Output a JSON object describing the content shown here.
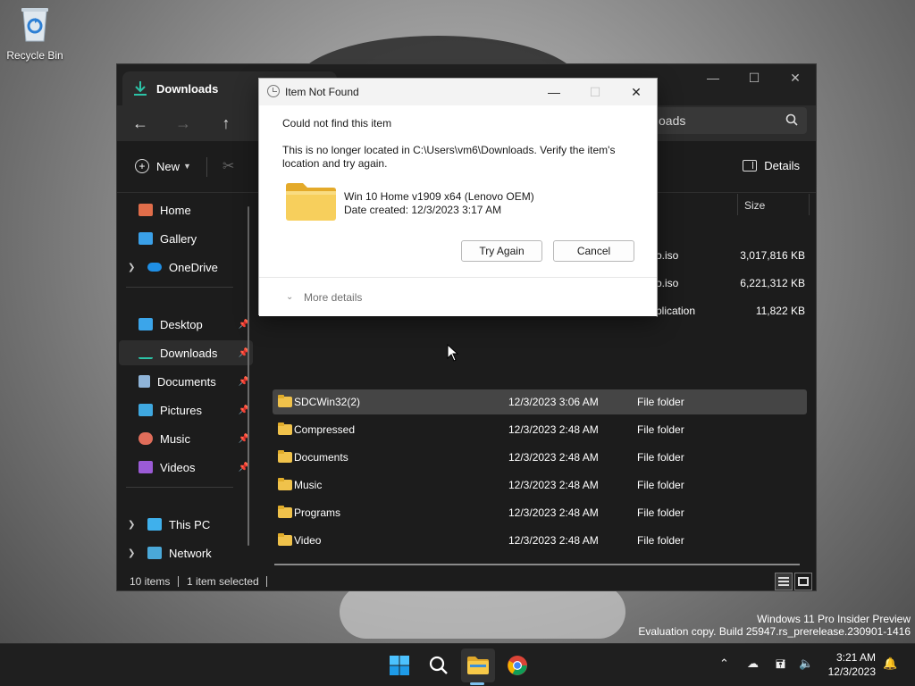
{
  "desktop": {
    "recycle_bin_label": "Recycle Bin",
    "watermark_line1": "Windows 11 Pro Insider Preview",
    "watermark_line2": "Evaluation copy. Build 25947.rs_prerelease.230901-1416"
  },
  "explorer": {
    "tab_title": "Downloads",
    "search_text": "oads",
    "toolbar": {
      "new_label": "New",
      "details_label": "Details"
    },
    "sidebar": {
      "items": [
        {
          "label": "Home",
          "icon": "home-icon"
        },
        {
          "label": "Gallery",
          "icon": "gallery-icon"
        },
        {
          "label": "OneDrive",
          "icon": "onedrive-icon",
          "expandable": true
        },
        {
          "label": "Desktop",
          "icon": "desktop-icon",
          "pinned": true
        },
        {
          "label": "Downloads",
          "icon": "downloads-icon",
          "pinned": true,
          "selected": true
        },
        {
          "label": "Documents",
          "icon": "documents-icon",
          "pinned": true
        },
        {
          "label": "Pictures",
          "icon": "pictures-icon",
          "pinned": true
        },
        {
          "label": "Music",
          "icon": "music-icon",
          "pinned": true
        },
        {
          "label": "Videos",
          "icon": "videos-icon",
          "pinned": true
        },
        {
          "label": "This PC",
          "icon": "this-pc-icon",
          "expandable": true
        },
        {
          "label": "Network",
          "icon": "network-icon",
          "expandable": true
        }
      ]
    },
    "columns": {
      "size": "Size"
    },
    "partial_rows": [
      {
        "name": "o.iso",
        "size": "3,017,816 KB"
      },
      {
        "name": "o.iso",
        "size": "6,221,312 KB"
      },
      {
        "name": "plication",
        "size": "11,822 KB"
      }
    ],
    "rows": [
      {
        "name": "SDCWin32(2)",
        "date": "12/3/2023 3:06 AM",
        "type": "File folder",
        "selected": true
      },
      {
        "name": "Compressed",
        "date": "12/3/2023 2:48 AM",
        "type": "File folder"
      },
      {
        "name": "Documents",
        "date": "12/3/2023 2:48 AM",
        "type": "File folder"
      },
      {
        "name": "Music",
        "date": "12/3/2023 2:48 AM",
        "type": "File folder"
      },
      {
        "name": "Programs",
        "date": "12/3/2023 2:48 AM",
        "type": "File folder"
      },
      {
        "name": "Video",
        "date": "12/3/2023 2:48 AM",
        "type": "File folder"
      }
    ],
    "status": {
      "items_count": "10 items",
      "selection": "1 item selected"
    }
  },
  "dialog": {
    "title": "Item Not Found",
    "heading": "Could not find this item",
    "message": "This is no longer located in C:\\Users\\vm6\\Downloads. Verify the item's location and try again.",
    "item_name": "Win 10 Home v1909 x64 (Lenovo OEM)",
    "item_date": "Date created: 12/3/2023 3:17 AM",
    "try_again_label": "Try Again",
    "cancel_label": "Cancel",
    "more_details_label": "More details"
  },
  "taskbar": {
    "apps": [
      "start-icon",
      "search-icon",
      "file-explorer-icon",
      "chrome-icon"
    ],
    "time": "3:21 AM",
    "date": "12/3/2023"
  },
  "colors": {
    "folder": "#f0c24b",
    "accent": "#7dc1ef",
    "dialog_bg": "#ffffff",
    "explorer_bg": "#1c1c1c"
  }
}
